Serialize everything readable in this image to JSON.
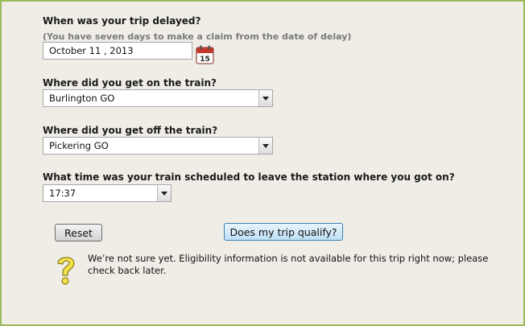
{
  "form": {
    "delay_question": "When was your trip delayed?",
    "delay_hint": "(You have seven days to make a claim from the date of delay)",
    "delay_date": "October 11 , 2013",
    "calendar_day": "15",
    "on_question": "Where did you get on the train?",
    "on_station": "Burlington GO",
    "off_question": "Where did you get off the train?",
    "off_station": "Pickering GO",
    "time_question": "What time was your train scheduled to leave the station where you got on?",
    "time_value": "17:37"
  },
  "buttons": {
    "reset": "Reset",
    "qualify": "Does my trip qualify?"
  },
  "result": {
    "message": "We’re not sure yet. Eligibility information is not available for this trip right now; please check back later."
  },
  "icons": {
    "calendar": "calendar-icon",
    "question": "question-mark-icon"
  },
  "colors": {
    "border": "#9bbb59",
    "background": "#efede6",
    "calendar_red": "#c0392b",
    "question_yellow": "#f2e34a"
  }
}
